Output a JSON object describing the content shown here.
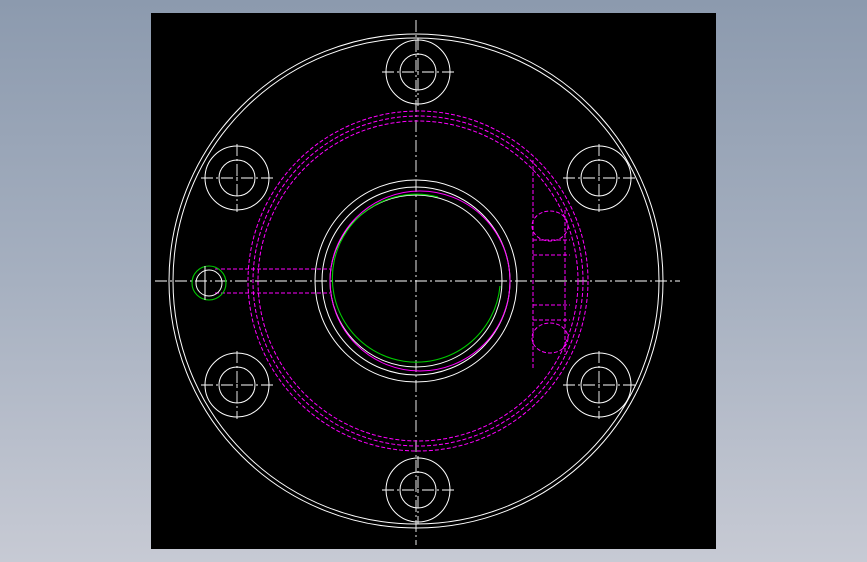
{
  "viewport": {
    "background": "#000000",
    "page_background": "gradient-grey-blue"
  },
  "colors": {
    "outline": "#ffffff",
    "hidden": "#ff00ff",
    "thread": "#00cc00"
  },
  "drawing": {
    "type": "cad-flange-front-view",
    "bolt_hole_count": 6,
    "layers": [
      "visible-outline",
      "hidden-lines",
      "center-lines",
      "thread-arc"
    ]
  }
}
